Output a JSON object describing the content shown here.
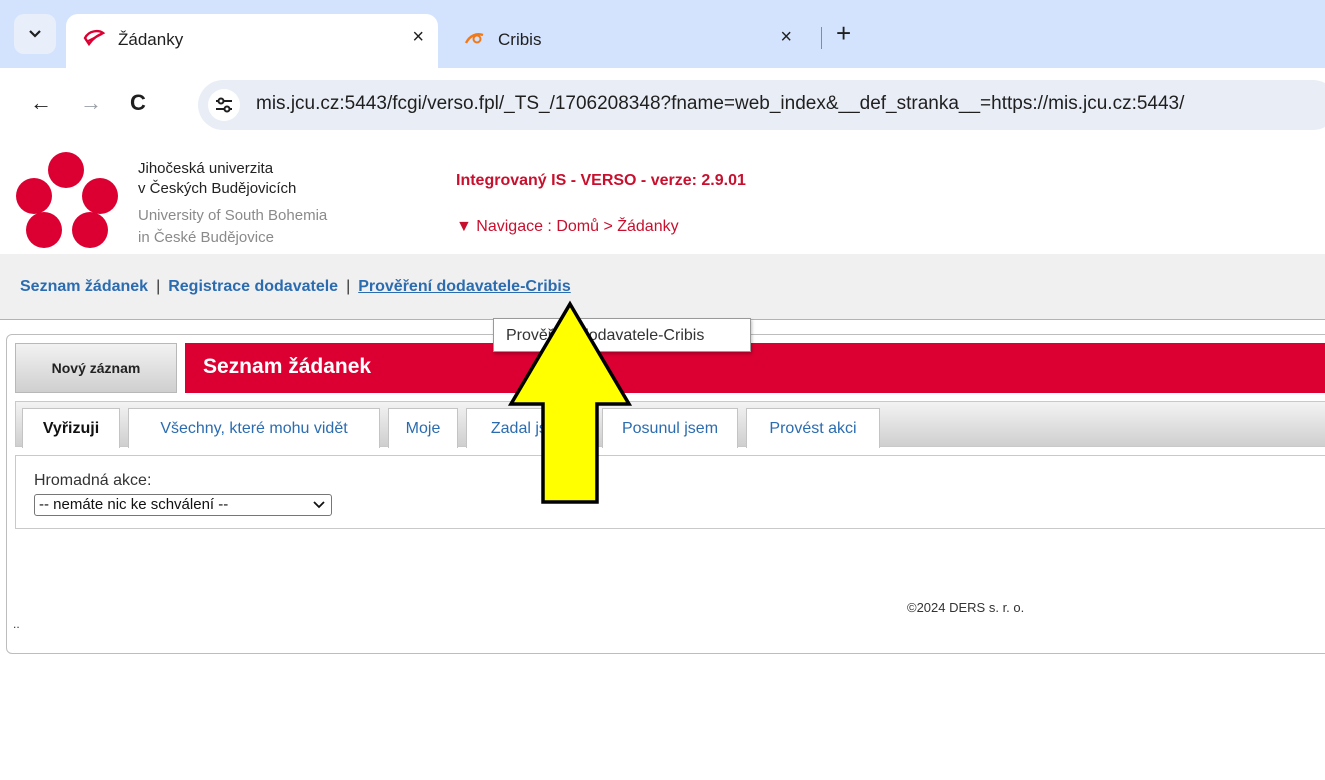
{
  "browser": {
    "tabs": [
      {
        "title": "Žádanky",
        "active": true,
        "close": "×"
      },
      {
        "title": "Cribis",
        "active": false,
        "close": "×"
      }
    ],
    "new_tab": "+",
    "back": "←",
    "forward": "→",
    "reload": "C",
    "url": "mis.jcu.cz:5443/fcgi/verso.fpl/_TS_/1706208348?fname=web_index&__def_stranka__=https://mis.jcu.cz:5443/"
  },
  "header": {
    "university_cz_1": "Jihočeská univerzita",
    "university_cz_2": "v Českých Budějovicích",
    "university_en_1": "University of South Bohemia",
    "university_en_2": "in České Budějovice",
    "app_title": "Integrovaný IS - VERSO - verze: 2.9.01",
    "breadcrumb": "▼ Navigace : Domů > Žádanky",
    "logo_color": "#dc0032"
  },
  "menu": {
    "items": [
      {
        "label": "Seznam žádanek"
      },
      {
        "label": "Registrace dodavatele"
      },
      {
        "label": "Prověření dodavatele-Cribis"
      }
    ],
    "separator": "|"
  },
  "tooltip": "Prověření dodavatele-Cribis",
  "panel": {
    "new_record": "Nový záznam",
    "title": "Seznam žádanek",
    "tabs": [
      {
        "label": "Vyřizuji",
        "selected": true
      },
      {
        "label": "Všechny, které mohu vidět"
      },
      {
        "label": "Moje"
      },
      {
        "label": "Zadal jsem"
      },
      {
        "label": "Posunul jsem"
      },
      {
        "label": "Provést akci"
      }
    ],
    "bulk_label": "Hromadná akce:",
    "bulk_select": "-- nemáte nic ke schválení --",
    "copyright": "©2024 DERS s. r. o.",
    "dots": ".."
  },
  "colors": {
    "accent_red": "#dc0032",
    "link_blue": "#2b6cb0",
    "arrow_yellow": "#ffff00"
  }
}
